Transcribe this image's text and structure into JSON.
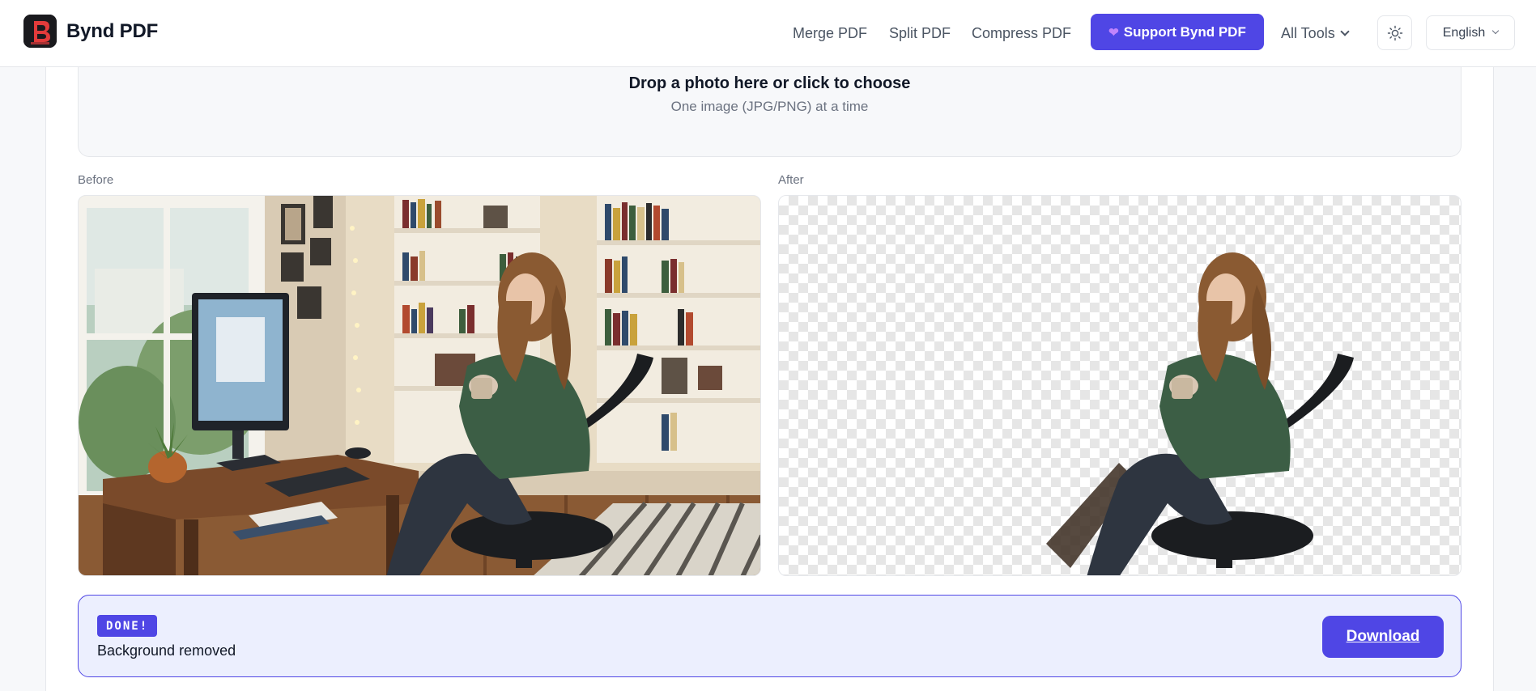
{
  "header": {
    "brand_name": "Bynd PDF",
    "logo_icon": "bynd-pdf-logo-icon",
    "nav": [
      {
        "label": "Merge PDF"
      },
      {
        "label": "Split PDF"
      },
      {
        "label": "Compress PDF"
      }
    ],
    "support_label": "Support Bynd PDF",
    "support_icon": "purple-heart-icon",
    "all_tools_label": "All Tools",
    "theme_icon": "sun-icon",
    "language": "English",
    "accent_color": "#4f46e5"
  },
  "dropzone": {
    "title": "Drop a photo here or click to choose",
    "subtitle": "One image (JPG/PNG) at a time"
  },
  "preview": {
    "before_label": "Before",
    "after_label": "After"
  },
  "status": {
    "badge": "DONE!",
    "message": "Background removed",
    "download_label": "Download"
  }
}
